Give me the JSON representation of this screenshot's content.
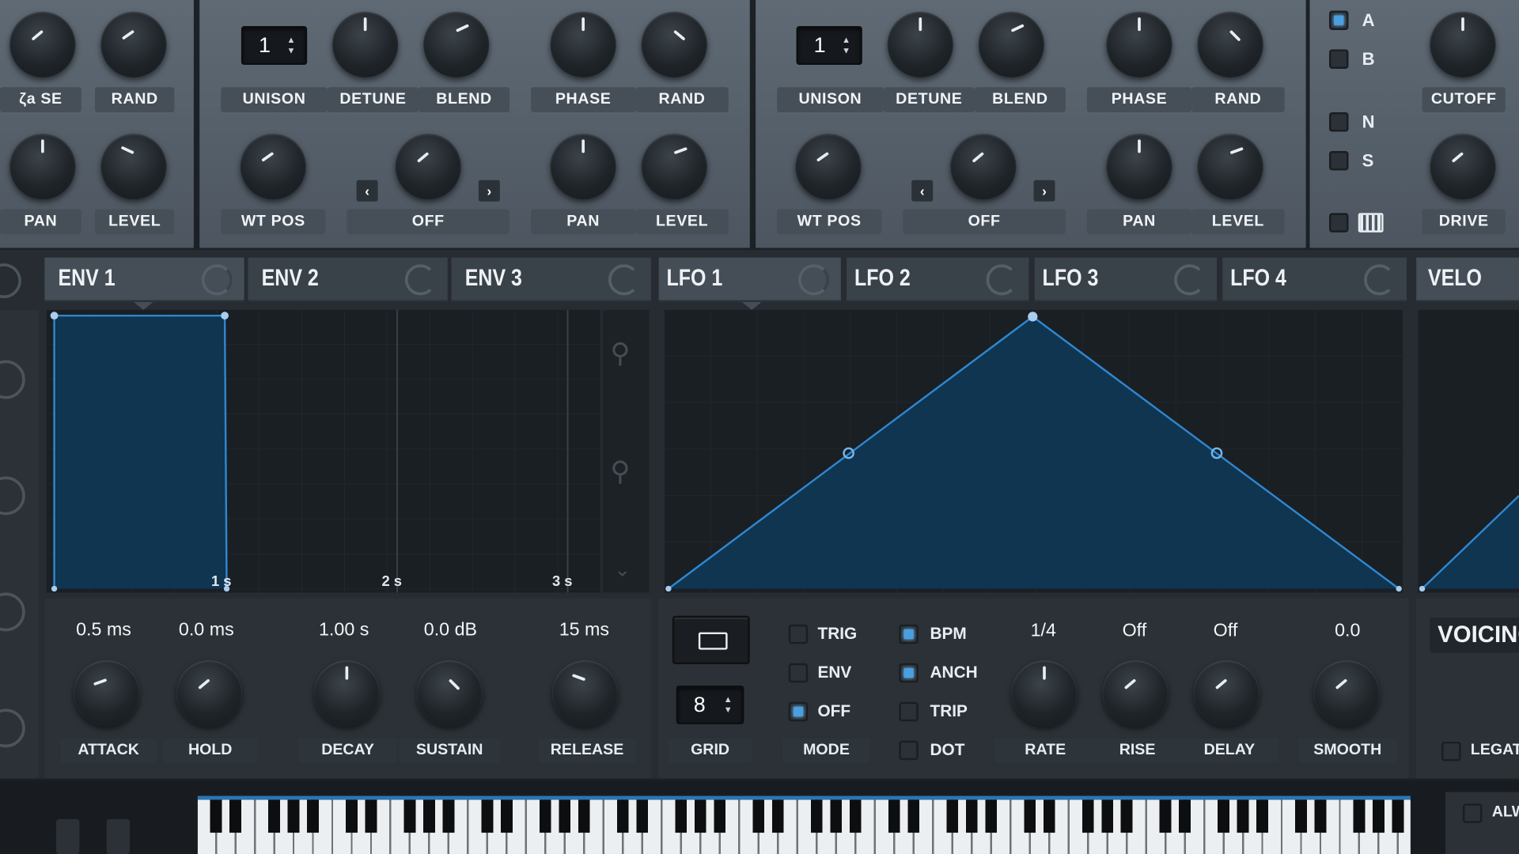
{
  "osc_left_partial": {
    "labels": [
      "PHASE",
      "RAND",
      "PAN",
      "LEVEL"
    ],
    "phase_label_visible": "ζа SE"
  },
  "osc_a": {
    "unison": "1",
    "labels": {
      "unison": "UNISON",
      "detune": "DETUNE",
      "blend": "BLEND",
      "phase": "PHASE",
      "rand": "RAND",
      "wt_pos": "WT POS",
      "warp": "OFF",
      "pan": "PAN",
      "level": "LEVEL"
    }
  },
  "osc_b": {
    "unison": "1",
    "labels": {
      "unison": "UNISON",
      "detune": "DETUNE",
      "blend": "BLEND",
      "phase": "PHASE",
      "rand": "RAND",
      "wt_pos": "WT POS",
      "warp": "OFF",
      "pan": "PAN",
      "level": "LEVEL"
    }
  },
  "filter": {
    "routes": [
      {
        "label": "A",
        "on": true
      },
      {
        "label": "B",
        "on": false
      },
      {
        "label": "N",
        "on": false
      },
      {
        "label": "S",
        "on": false
      }
    ],
    "cutoff_label": "CUTOFF",
    "drive_label": "DRIVE"
  },
  "tabs": {
    "env": [
      "ENV 1",
      "ENV 2",
      "ENV 3"
    ],
    "lfo": [
      "LFO 1",
      "LFO 2",
      "LFO 3",
      "LFO 4"
    ],
    "velo": "VELO"
  },
  "env_graph": {
    "time_marks": [
      "1 s",
      "2 s",
      "3 s"
    ]
  },
  "env_controls": [
    {
      "value": "0.5 ms",
      "label": "ATTACK"
    },
    {
      "value": "0.0 ms",
      "label": "HOLD"
    },
    {
      "value": "1.00 s",
      "label": "DECAY"
    },
    {
      "value": "0.0 dB",
      "label": "SUSTAIN"
    },
    {
      "value": "15 ms",
      "label": "RELEASE"
    }
  ],
  "lfo_controls": {
    "grid_value": "8",
    "grid_label": "GRID",
    "mode_label": "MODE",
    "mode_options": [
      {
        "label": "TRIG",
        "on": false
      },
      {
        "label": "ENV",
        "on": false
      },
      {
        "label": "OFF",
        "on": true
      }
    ],
    "options": [
      {
        "label": "BPM",
        "on": true
      },
      {
        "label": "ANCH",
        "on": true
      },
      {
        "label": "TRIP",
        "on": false
      },
      {
        "label": "DOT",
        "on": false
      }
    ],
    "knobs": [
      {
        "value": "1/4",
        "label": "RATE"
      },
      {
        "value": "Off",
        "label": "RISE"
      },
      {
        "value": "Off",
        "label": "DELAY"
      },
      {
        "value": "0.0",
        "label": "SMOOTH"
      }
    ]
  },
  "voicing": {
    "title": "VOICING",
    "legato": "LEGATO",
    "always": "ALW"
  },
  "colors": {
    "accent": "#4a9fe0",
    "graph_fill": "#0f3550",
    "line": "#2f86cf"
  }
}
